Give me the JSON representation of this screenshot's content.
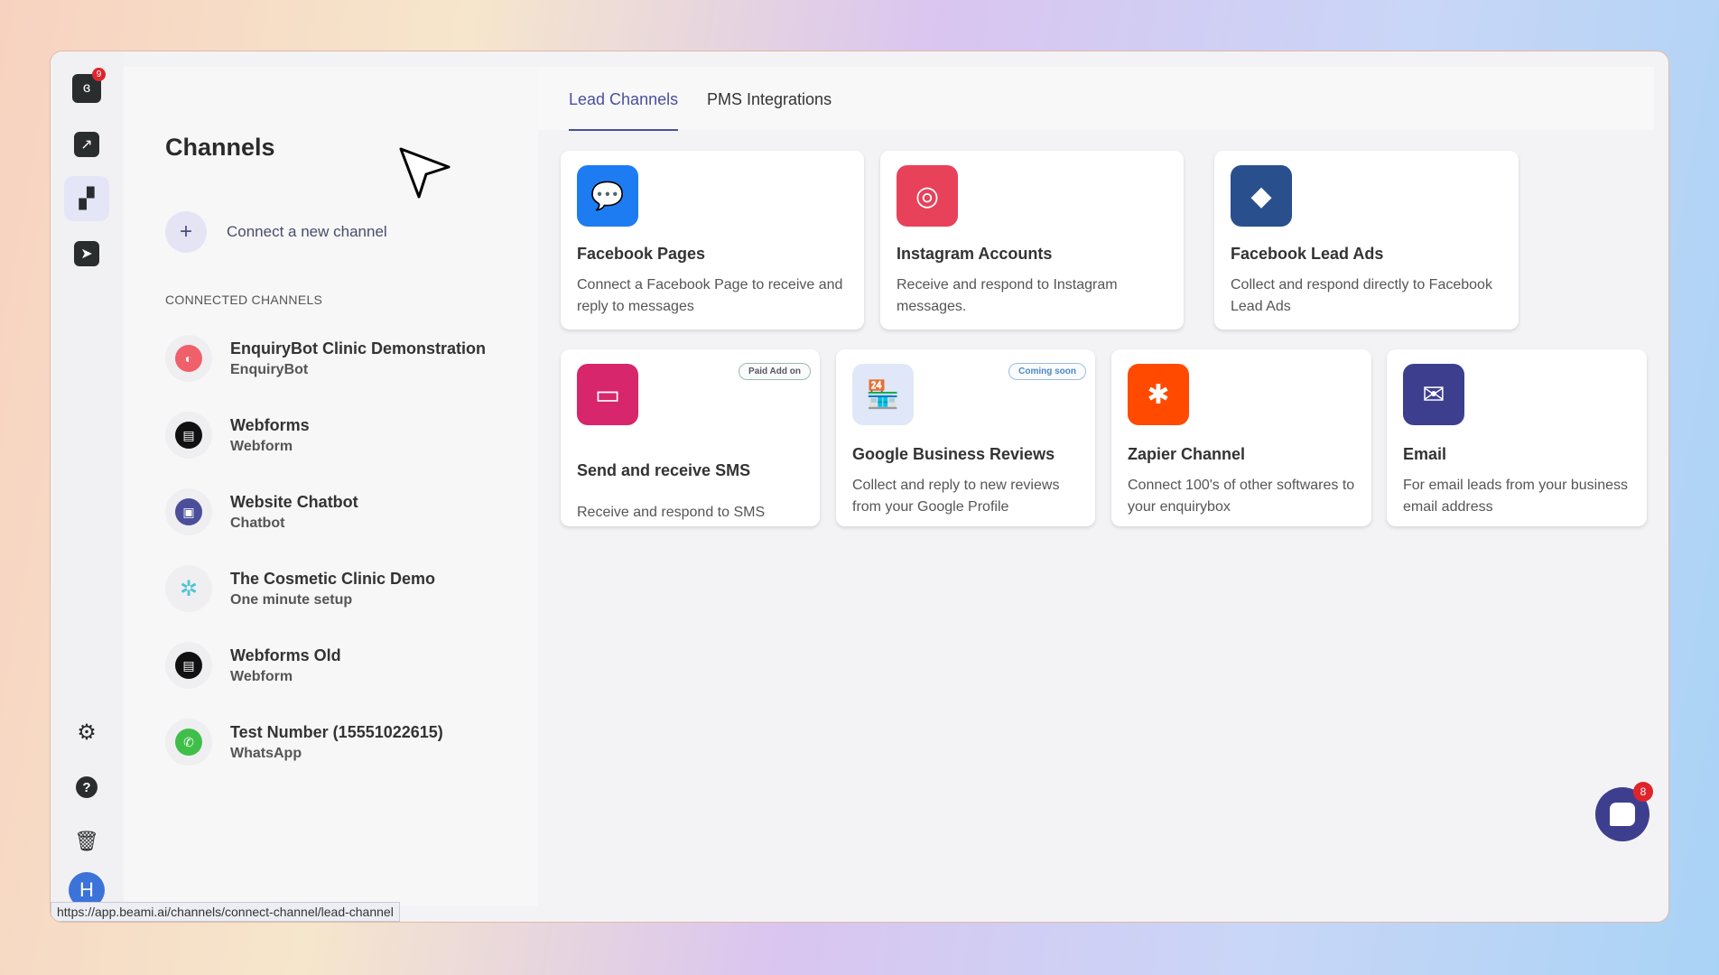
{
  "rail": {
    "logo_badge": "9",
    "avatar_initial": "H"
  },
  "left": {
    "title": "Channels",
    "connect_label": "Connect a new channel",
    "section_label": "CONNECTED CHANNELS",
    "channels": [
      {
        "name": "EnquiryBot Clinic Demonstration",
        "type": "EnquiryBot",
        "icon": "enquirybot-icon",
        "color": "#f0606a"
      },
      {
        "name": "Webforms",
        "type": "Webform",
        "icon": "webform-icon",
        "color": "#111111"
      },
      {
        "name": "Website Chatbot",
        "type": "Chatbot",
        "icon": "chatbot-icon",
        "color": "#4b4f9a"
      },
      {
        "name": "The Cosmetic Clinic Demo",
        "type": "One minute setup",
        "icon": "sparkle-icon",
        "color": "#4ec3d4"
      },
      {
        "name": "Webforms Old",
        "type": "Webform",
        "icon": "webform-icon",
        "color": "#111111"
      },
      {
        "name": "Test Number (15551022615)",
        "type": "WhatsApp",
        "icon": "whatsapp-icon",
        "color": "#3fbf4a"
      }
    ]
  },
  "tabs": [
    {
      "label": "Lead Channels"
    },
    {
      "label": "PMS Integrations"
    }
  ],
  "cards": [
    {
      "title": "Facebook Pages",
      "desc": "Connect a Facebook Page to receive and reply to messages",
      "color": "#1e7cf2"
    },
    {
      "title": "Instagram Accounts",
      "desc": "Receive and respond to Instagram messages.",
      "color": "#e8415a"
    },
    {
      "title": "Facebook Lead Ads",
      "desc": "Collect and respond directly to Facebook Lead Ads",
      "color": "#2a4f8d"
    },
    {
      "title": "Send and receive SMS",
      "desc": "Receive and respond to SMS",
      "tag": "Paid Add on",
      "color": "#d7266b"
    },
    {
      "title": "Google Business Reviews",
      "desc": "Collect and reply to new reviews from your Google Profile",
      "tag": "Coming soon",
      "color": "#dfe7f8"
    },
    {
      "title": "Zapier Channel",
      "desc": "Connect 100's of other softwares to your enquirybox",
      "color": "#ff4a00"
    },
    {
      "title": "Email",
      "desc": "For email leads from your business email address",
      "color": "#3d3f8e"
    }
  ],
  "chat": {
    "badge": "8"
  },
  "status_url": "https://app.beami.ai/channels/connect-channel/lead-channel"
}
